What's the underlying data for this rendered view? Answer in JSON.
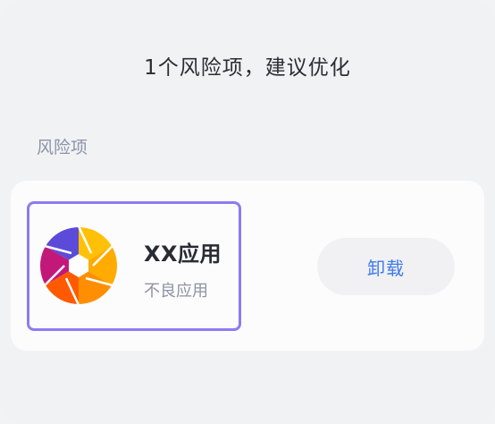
{
  "header": {
    "title": "1个风险项，建议优化"
  },
  "section": {
    "label": "风险项"
  },
  "risk_item": {
    "app_name": "XX应用",
    "app_description": "不良应用",
    "icon": "camera-shutter-icon",
    "action_label": "卸载"
  },
  "colors": {
    "accent": "#3f7bea",
    "highlight_border": "#8b7cf0",
    "background": "#f1f2f4",
    "card": "#fcfcfd"
  }
}
